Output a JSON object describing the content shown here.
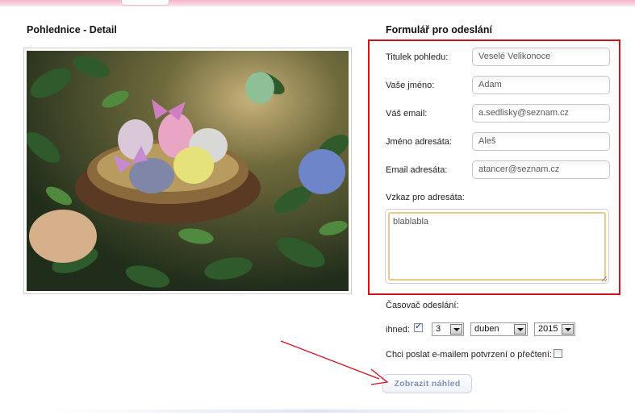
{
  "left": {
    "title": "Pohlednice - Detail"
  },
  "form": {
    "title": "Formulář pro odeslání",
    "fields": [
      {
        "label": "Titulek pohledu:",
        "value": "Veselé Velikonoce"
      },
      {
        "label": "Vaše jméno:",
        "value": "Adam"
      },
      {
        "label": "Váš email:",
        "value": "a.sedlisky@seznam.cz"
      },
      {
        "label": "Jméno adresáta:",
        "value": "Aleš"
      },
      {
        "label": "Email adresáta:",
        "value": "atancer@seznam.cz"
      }
    ],
    "message": {
      "label": "Vzkaz pro adresáta:",
      "value": "blablabla"
    }
  },
  "timer": {
    "label": "Časovač odeslání:",
    "immediate_label": "ihned:",
    "immediate_checked": true,
    "day": "3",
    "month": "duben",
    "year": "2015"
  },
  "confirm": {
    "label": "Chci poslat e-mailem potvrzení o přečtení:",
    "checked": false
  },
  "preview_button": "Zobrazit náhled",
  "colors": {
    "highlight_box": "#d0121e",
    "arrow": "#d0121e",
    "textarea_focus": "#e8c988",
    "button_text": "#7f93b5"
  }
}
